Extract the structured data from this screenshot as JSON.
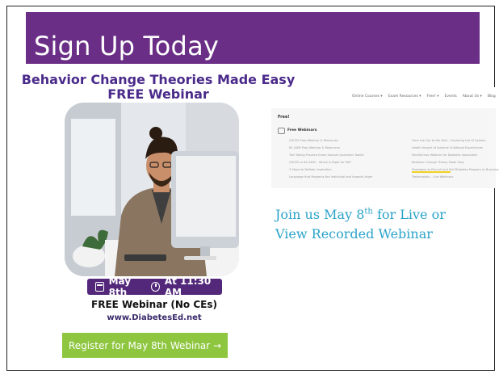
{
  "slide": {
    "title": "Sign Up Today",
    "accent_color": "#6a2e86"
  },
  "promo": {
    "heading_line1": "Behavior Change Theories Made Easy",
    "heading_line2": "FREE Webinar",
    "date": "May 8th",
    "time": "At 11:30 AM",
    "free_text": "FREE Webinar (No CEs)",
    "url": "www.DiabetesEd.net",
    "register_label": "Register for May 8th Webinar →",
    "register_color": "#8ec63f"
  },
  "website": {
    "nav": [
      "Online Courses ▾",
      "Exam Resources ▾",
      "Free! ▾",
      "Events",
      "About Us ▾",
      "Blog"
    ],
    "panel_title": "Free!",
    "section_title": "Free Webinars",
    "left_items": [
      "CDCES Prep Webinar & Resources",
      "BC-ADM Prep Webinar & Resources",
      "Test Taking Practice Exam Sample Questions Toolkit",
      "CDCES or BC-ADM – Which is Right for Me?",
      "3 Steps to Deflate Inspiration",
      "Language that Respects the Individual and Impacts Hope"
    ],
    "right_items": [
      "From the Gut to the Butt – Exploring the GI System",
      "Health Impact of Adverse Childhood Experiences",
      "Mindfulness Webinar for Diabetes Specialists",
      "Behavior Change Theory Made Easy",
      "Strategies to Recruit and Sell Diabetes Program or Business",
      "Testimonials – Live Webinars"
    ]
  },
  "join": {
    "line1_pre": "Join us May 8",
    "line1_sup": "th",
    "line1_post": " for Live or",
    "line2": "View Recorded Webinar"
  }
}
